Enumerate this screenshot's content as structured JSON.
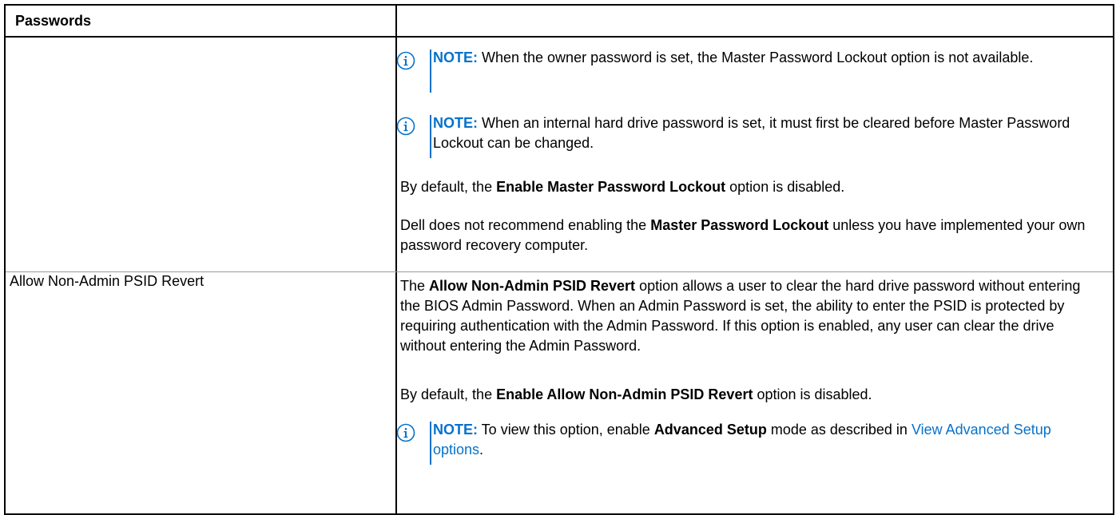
{
  "table": {
    "header_left": "Passwords",
    "header_right": ""
  },
  "row1": {
    "note1": {
      "label": "NOTE:",
      "text": " When the owner password is set, the Master Password Lockout option is not available."
    },
    "note2": {
      "label": "NOTE:",
      "text": " When an internal hard drive password is set, it must first be cleared before Master Password Lockout can be changed."
    },
    "para1": {
      "pre": "By default, the ",
      "bold": "Enable Master Password Lockout",
      "post": " option is disabled."
    },
    "para2": {
      "pre": "Dell does not recommend enabling the ",
      "bold": "Master Password Lockout",
      "post": " unless you have implemented your own password recovery computer."
    }
  },
  "row2": {
    "setting": "Allow Non-Admin PSID Revert",
    "desc": {
      "pre": "The ",
      "bold": "Allow Non-Admin PSID Revert",
      "post": " option allows a user to clear the hard drive password without entering the BIOS Admin Password. When an Admin Password is set, the ability to enter the PSID is protected by requiring authentication with the Admin Password. If this option is enabled, any user can clear the drive without entering the Admin Password."
    },
    "para": {
      "pre": "By default, the ",
      "bold": "Enable Allow Non-Admin PSID Revert",
      "post": " option is disabled."
    },
    "note": {
      "label": "NOTE:",
      "pre": " To view this option, enable ",
      "bold": "Advanced Setup",
      "mid": " mode as described in ",
      "link": "View Advanced Setup options",
      "post": "."
    }
  },
  "colors": {
    "accent": "#0672cb",
    "border": "#000000"
  },
  "icons": {
    "note": "info-circle-icon"
  }
}
